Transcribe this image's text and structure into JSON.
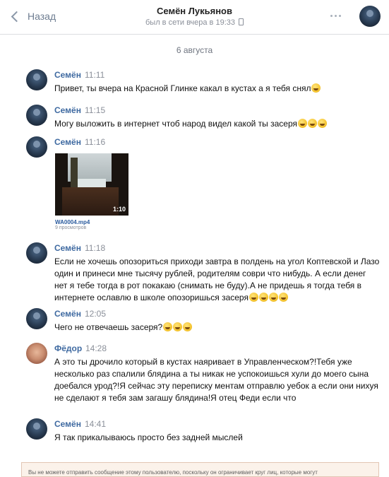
{
  "header": {
    "back_label": "Назад",
    "title": "Семён Лукьянов",
    "status": "был в сети вчера в 19:33"
  },
  "date_separator": "6 августа",
  "messages": [
    {
      "author": "Семён",
      "time": "11:11",
      "text": "Привет, ты вчера на Красной Глинке какал в кустах а я тебя снял",
      "emoji_count": 1
    },
    {
      "author": "Семён",
      "time": "11:15",
      "text": "Могу выложить в интернет чтоб народ видел какой ты засеря",
      "emoji_count": 3
    },
    {
      "author": "Семён",
      "time": "11:16",
      "text": "",
      "emoji_count": 0,
      "attachment": {
        "duration": "1:10",
        "filename": "WA0004.mp4",
        "views": "9 просмотров"
      }
    },
    {
      "author": "Семён",
      "time": "11:18",
      "text": "Если не хочешь опозориться приходи завтра в полдень на угол Коптевской и Лазо один и принеси мне тысячу рублей, родителям соври что нибудь. А если денег нет я тебе тогда в рот покакаю (снимать не буду).А не придешь я тогда тебя в интернете ославлю в школе опозоришься засеря",
      "emoji_count": 4
    },
    {
      "author": "Семён",
      "time": "12:05",
      "text": "Чего не отвечаешь засеря?",
      "emoji_count": 3
    },
    {
      "author": "Фёдор",
      "time": "14:28",
      "text": "А это ты дрочило который в кустах наяривает в Управленческом?!Тебя уже несколько раз спалили блядина а ты никак не успокоишься хули до моего сына доебался урод?!Я сейчас эту переписку ментам отправлю уебок а если они нихуя не сделают я тебя зам загашу блядина!Я отец Феди если что",
      "emoji_count": 0
    },
    {
      "author": "Семён",
      "time": "14:41",
      "text": "Я так прикалываюсь просто без задней мыслей",
      "emoji_count": 0
    }
  ],
  "footer_notice": "Вы не можете отправить сообщение этому пользователю, поскольку он ограничивает круг лиц, которые могут"
}
